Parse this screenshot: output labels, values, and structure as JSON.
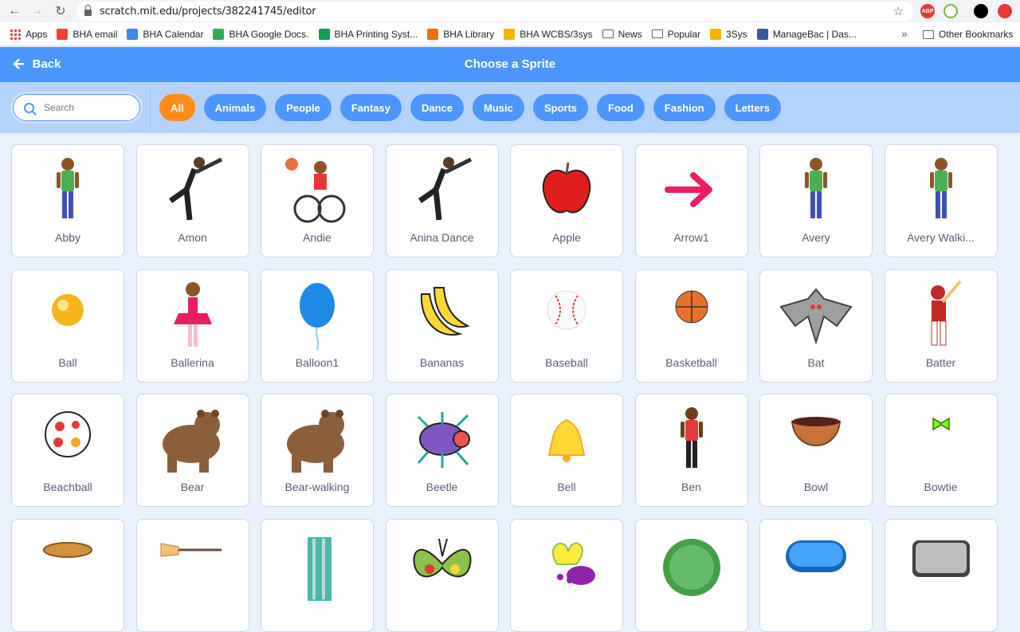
{
  "browser": {
    "url": "scratch.mit.edu/projects/382241745/editor",
    "bookmarks": [
      {
        "label": "Apps",
        "icon": "apps-grid-icon",
        "color": "#ea4335"
      },
      {
        "label": "BHA email",
        "icon": "gmail-icon",
        "color": "#ea4335"
      },
      {
        "label": "BHA Calendar",
        "icon": "calendar-icon",
        "color": "#4285f4"
      },
      {
        "label": "BHA Google Docs.",
        "icon": "drive-icon",
        "color": "#34a853"
      },
      {
        "label": "BHA Printing Syst...",
        "icon": "printing-icon",
        "color": "#0f9d58"
      },
      {
        "label": "BHA Library",
        "icon": "library-icon",
        "color": "#e8710a"
      },
      {
        "label": "BHA WCBS/3sys",
        "icon": "wcbs-icon",
        "color": "#f4b400"
      },
      {
        "label": "News",
        "icon": "folder-icon",
        "color": "#5f6368"
      },
      {
        "label": "Popular",
        "icon": "folder-icon",
        "color": "#5f6368"
      },
      {
        "label": "3Sys",
        "icon": "sys-icon",
        "color": "#f4b400"
      },
      {
        "label": "ManageBac | Das...",
        "icon": "managebac-icon",
        "color": "#3b5998"
      }
    ],
    "overflow_label": "»",
    "other_bookmarks": "Other Bookmarks"
  },
  "header": {
    "back_label": "Back",
    "title": "Choose a Sprite"
  },
  "filter": {
    "search_placeholder": "Search",
    "tags": [
      "All",
      "Animals",
      "People",
      "Fantasy",
      "Dance",
      "Music",
      "Sports",
      "Food",
      "Fashion",
      "Letters"
    ],
    "active_tag": "All"
  },
  "sprites": [
    {
      "name": "Abby",
      "icon": "girl-figure"
    },
    {
      "name": "Amon",
      "icon": "dancer-figure"
    },
    {
      "name": "Andie",
      "icon": "wheelchair-figure"
    },
    {
      "name": "Anina Dance",
      "icon": "dancer-figure"
    },
    {
      "name": "Apple",
      "icon": "apple"
    },
    {
      "name": "Arrow1",
      "icon": "arrow"
    },
    {
      "name": "Avery",
      "icon": "girl-figure"
    },
    {
      "name": "Avery Walki...",
      "icon": "girl-figure"
    },
    {
      "name": "Ball",
      "icon": "ball"
    },
    {
      "name": "Ballerina",
      "icon": "ballerina"
    },
    {
      "name": "Balloon1",
      "icon": "balloon"
    },
    {
      "name": "Bananas",
      "icon": "bananas"
    },
    {
      "name": "Baseball",
      "icon": "baseball"
    },
    {
      "name": "Basketball",
      "icon": "basketball"
    },
    {
      "name": "Bat",
      "icon": "bat"
    },
    {
      "name": "Batter",
      "icon": "batter"
    },
    {
      "name": "Beachball",
      "icon": "beachball"
    },
    {
      "name": "Bear",
      "icon": "bear"
    },
    {
      "name": "Bear-walking",
      "icon": "bear"
    },
    {
      "name": "Beetle",
      "icon": "beetle"
    },
    {
      "name": "Bell",
      "icon": "bell"
    },
    {
      "name": "Ben",
      "icon": "boy-figure"
    },
    {
      "name": "Bowl",
      "icon": "bowl"
    },
    {
      "name": "Bowtie",
      "icon": "bowtie"
    },
    {
      "name": "",
      "icon": "bread"
    },
    {
      "name": "",
      "icon": "broom"
    },
    {
      "name": "",
      "icon": "building"
    },
    {
      "name": "",
      "icon": "butterfly"
    },
    {
      "name": "",
      "icon": "butterfly2"
    },
    {
      "name": "",
      "icon": "green-button"
    },
    {
      "name": "",
      "icon": "blue-button"
    },
    {
      "name": "",
      "icon": "gray-button"
    }
  ],
  "colors": {
    "header": "#4c97ff",
    "filter_bg": "#b5d2fb",
    "active_tag": "#ff8c1a",
    "tag": "#4c97ff",
    "page_bg": "#e9f1fc"
  }
}
